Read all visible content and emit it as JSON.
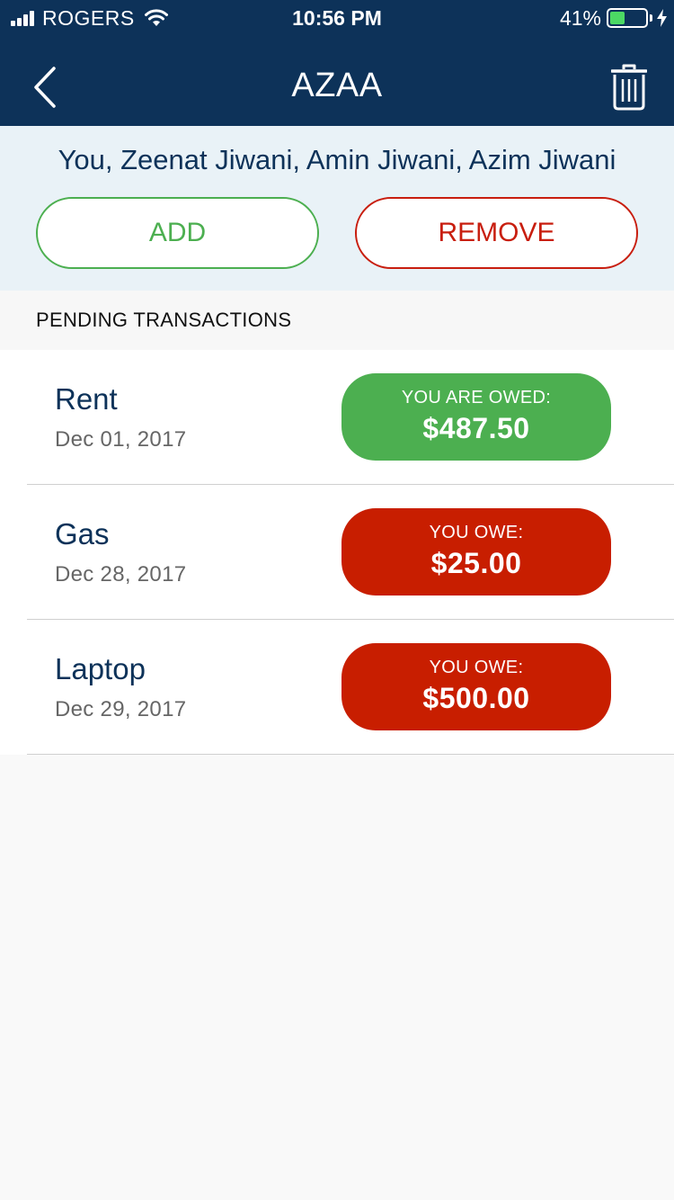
{
  "status_bar": {
    "carrier": "ROGERS",
    "time": "10:56 PM",
    "battery_percent": "41%",
    "battery_level": 0.41,
    "icons": [
      "signal-icon",
      "wifi-icon",
      "battery-icon",
      "charging-bolt-icon"
    ]
  },
  "nav": {
    "title": "AZAA",
    "back_icon": "chevron-left-icon",
    "trash_icon": "trash-icon"
  },
  "members": {
    "text": "You, Zeenat Jiwani, Amin Jiwani, Azim Jiwani",
    "add_label": "ADD",
    "remove_label": "REMOVE"
  },
  "section": {
    "title": "PENDING TRANSACTIONS"
  },
  "transactions": [
    {
      "title": "Rent",
      "date": "Dec 01, 2017",
      "label": "YOU ARE OWED:",
      "amount": "$487.50",
      "status": "owed",
      "color": "#4caf50"
    },
    {
      "title": "Gas",
      "date": "Dec 28, 2017",
      "label": "YOU OWE:",
      "amount": "$25.00",
      "status": "owe",
      "color": "#c81e00"
    },
    {
      "title": "Laptop",
      "date": "Dec 29, 2017",
      "label": "YOU OWE:",
      "amount": "$500.00",
      "status": "owe",
      "color": "#c81e00"
    }
  ],
  "colors": {
    "header_bg": "#0d3259",
    "panel_bg": "#e9f2f7",
    "accent_green": "#4caf50",
    "accent_red": "#c81e00"
  }
}
